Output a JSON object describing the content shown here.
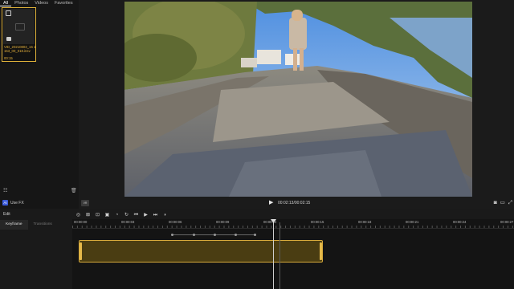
{
  "media_panel": {
    "tabs": [
      "All",
      "Photos",
      "Videos",
      "Favorites"
    ],
    "item": {
      "name": "VID_20210803_16 1153_00_018.insv",
      "duration": "00:15"
    },
    "footer_left_icon": "filter-icon",
    "footer_right_icon": "trash-icon"
  },
  "ai_bar": {
    "icon_text": "AI",
    "label": "Use FX"
  },
  "player": {
    "chip_text": "VR",
    "time": "00:02:13/00:02:15",
    "icons": [
      "camera-icon",
      "ratio-icon",
      "fullscreen-icon"
    ]
  },
  "edit_panel": {
    "title": "Edit",
    "tabs": [
      "Keyframe",
      "Transitions"
    ]
  },
  "timeline": {
    "toolbar_icons": [
      "target-icon",
      "crop-icon",
      "frame-icon",
      "snapshot-icon",
      "speed-icon",
      "rotate-icon",
      "prev-keyframe-icon",
      "play-icon",
      "next-keyframe-icon",
      "split-icon"
    ],
    "ticks": [
      "00:00:00",
      "00:00:03",
      "00:00:06",
      "00:00:09",
      "00:00:12",
      "00:00:15",
      "00:00:18",
      "00:00:21",
      "00:00:24",
      "00:00:27"
    ]
  },
  "colors": {
    "accent": "#e6b23c",
    "clip_fill": "#4a3d12",
    "background": "#1a1a1a"
  }
}
